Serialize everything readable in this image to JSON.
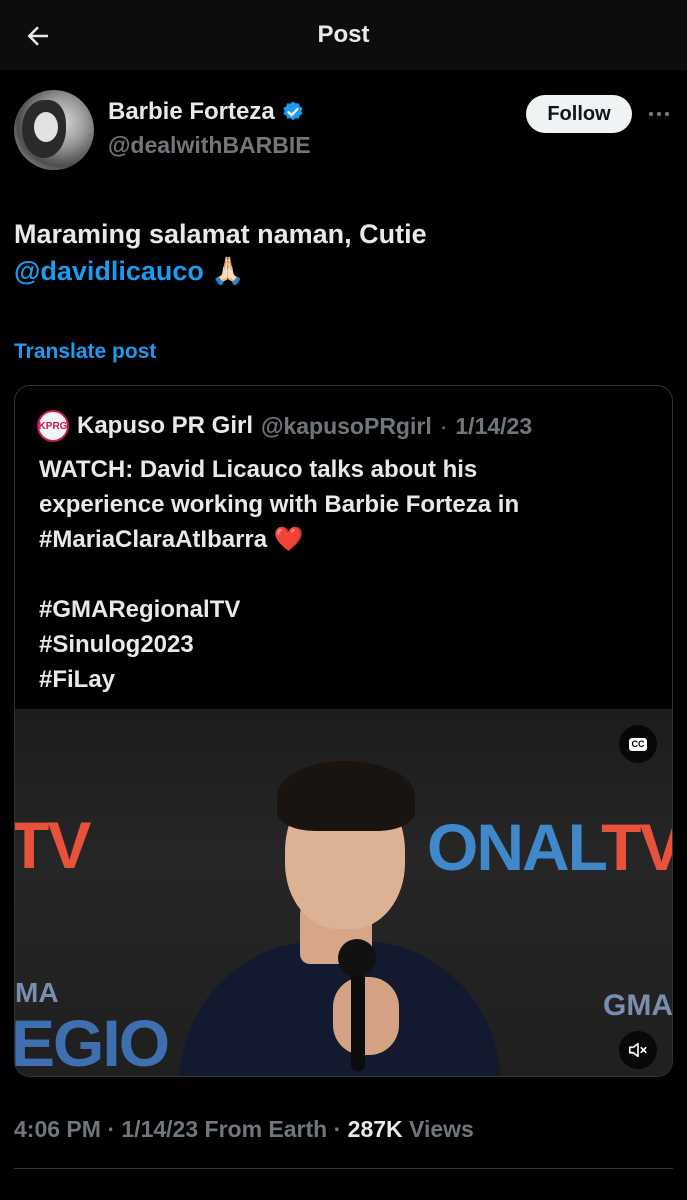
{
  "topbar": {
    "title": "Post"
  },
  "author": {
    "name": "Barbie Forteza",
    "handle": "@dealwithBARBIE",
    "follow_label": "Follow"
  },
  "post": {
    "text": "Maraming salamat naman, Cutie",
    "mention": "@davidlicauco",
    "emoji": "🙏🏻",
    "translate_label": "Translate post"
  },
  "quote": {
    "avatar_text": "KPRG",
    "name": "Kapuso PR Girl",
    "handle": "@kapusoPRgirl",
    "separator": "·",
    "date": "1/14/23",
    "line1": "WATCH: David Licauco talks about his",
    "line2": "experience working with Barbie Forteza in",
    "line3": "#MariaClaraAtIbarra ❤️",
    "tag1": "#GMARegionalTV",
    "tag2": "#Sinulog2023",
    "tag3": "#FiLay",
    "video": {
      "cc_label": "CC",
      "backdrop_left": "TV",
      "backdrop_right": "ONAL",
      "backdrop_right_tail": "TV",
      "backdrop_gma_left": "MA",
      "backdrop_regio": "EGIO",
      "backdrop_gma_right": "GMA"
    }
  },
  "meta": {
    "time": "4:06 PM",
    "date": "1/14/23",
    "source": "From Earth",
    "views_count": "287K",
    "views_label": "Views",
    "separator": "·"
  },
  "icons": {
    "back": "arrow-left-icon",
    "verified": "verified-badge-icon",
    "more": "more-horizontal-icon",
    "captions": "closed-captions-icon",
    "mute": "speaker-muted-icon"
  },
  "colors": {
    "accent": "#1d9bf0",
    "background": "#000000",
    "muted": "#71767b"
  }
}
